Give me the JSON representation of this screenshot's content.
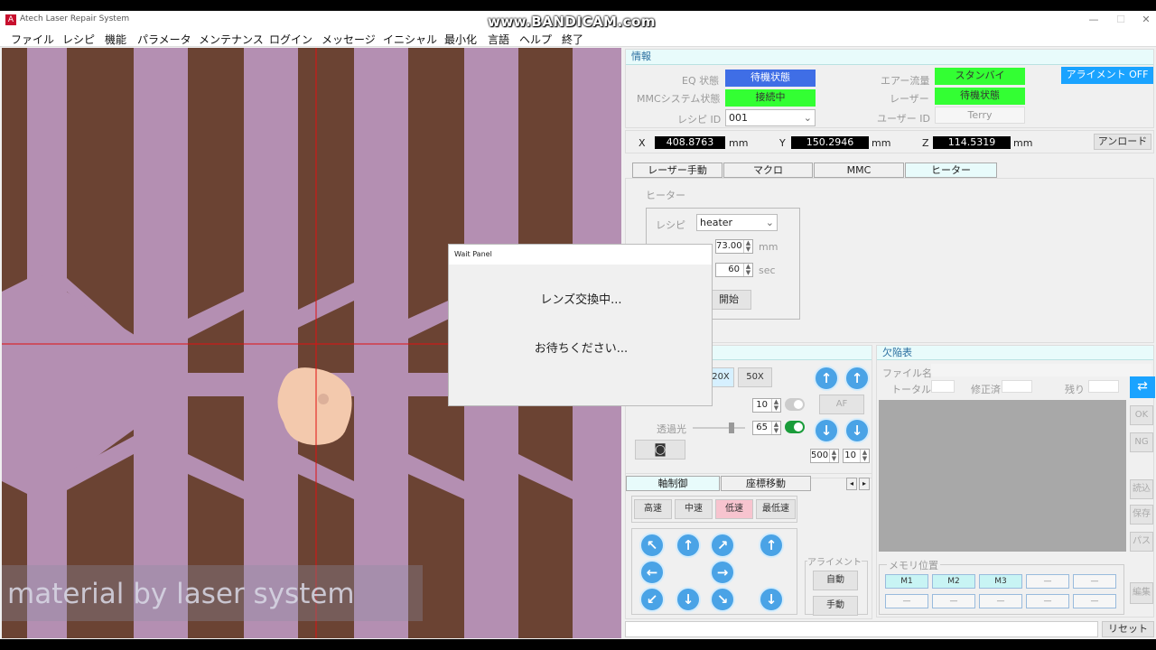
{
  "window": {
    "title": "Atech Laser Repair System",
    "minimize": "—",
    "maximize": "☐",
    "close": "✕"
  },
  "watermark": "www.BANDICAM.com",
  "menu": [
    "ファイル",
    "レシピ",
    "機能",
    "パラメータ",
    "メンテナンス",
    "ログイン",
    "メッセージ",
    "イニシャル",
    "最小化",
    "言語",
    "ヘルプ",
    "終了"
  ],
  "camera": {
    "overlay_text": "material by laser system"
  },
  "info": {
    "header": "情報",
    "eq_label": "EQ 状態",
    "eq_value": "待機状態",
    "eq_color": "#3f6ee6",
    "mmc_label": "MMCシステム状態",
    "mmc_value": "接続中",
    "recipe_label": "レシピ ID",
    "recipe_value": "001",
    "air_label": "エアー流量",
    "air_value": "スタンバイ",
    "laser_label": "レーザー",
    "laser_value": "待機状態",
    "user_label": "ユーザー ID",
    "user_value": "Terry",
    "align_btn": "アライメント OFF",
    "accent": "#33ff33",
    "align_color": "#1aa3ff"
  },
  "coords": {
    "x_label": "X",
    "x": "408.8763",
    "y_label": "Y",
    "y": "150.2946",
    "z_label": "Z",
    "z": "114.5319",
    "unit": "mm",
    "unload": "アンロード"
  },
  "tabs": [
    "レーザー手動",
    "マクロ",
    "MMC",
    "ヒーター"
  ],
  "heater": {
    "group": "ヒーター",
    "recipe_label": "レシピ",
    "recipe_value": "heater",
    "v1": "73.00",
    "u1": "mm",
    "v2": "60",
    "u2": "sec",
    "start": "開始"
  },
  "lens": {
    "b20": "20X",
    "b50": "50X",
    "af": "AF",
    "light_label": "透過光",
    "v1": "10",
    "v2": "65",
    "v3": "500",
    "v4": "10"
  },
  "defect": {
    "header": "欠陥表",
    "file_label": "ファイル名",
    "total_label": "トータル",
    "fixed_label": "修正済",
    "remain_label": "残り",
    "btns": [
      "OK",
      "NG",
      "読込",
      "保存",
      "パス"
    ]
  },
  "axis": {
    "tab1": "軸制御",
    "tab2": "座標移動",
    "speeds": [
      "高速",
      "中速",
      "低速",
      "最低速"
    ],
    "align_group": "アライメント",
    "auto": "自動",
    "manual": "手動"
  },
  "memory": {
    "group": "メモリ位置",
    "slots": [
      "M1",
      "M2",
      "M3",
      "—",
      "—",
      "—",
      "—",
      "—",
      "—",
      "—"
    ],
    "edit": "編集"
  },
  "status": {
    "reset": "リセット"
  },
  "modal": {
    "title": "Wait Panel",
    "line1": "レンズ交換中...",
    "line2": "お待ちください..."
  }
}
